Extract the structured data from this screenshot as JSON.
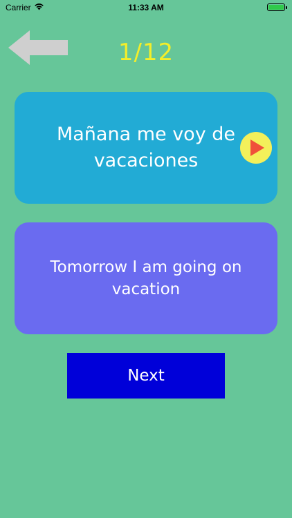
{
  "status_bar": {
    "carrier": "Carrier",
    "time": "11:33 AM",
    "battery_level": 1.0,
    "icons": {
      "wifi": "wifi-icon",
      "battery": "battery-icon"
    }
  },
  "navigation": {
    "back_icon": "arrow-left-icon"
  },
  "progress": {
    "counter": "1/12",
    "current": 1,
    "total": 12
  },
  "cards": {
    "spanish": {
      "text": "Mañana me voy de vacaciones",
      "play_icon": "play-icon"
    },
    "english": {
      "text": "Tomorrow I am going on vacation"
    }
  },
  "actions": {
    "next_label": "Next"
  },
  "colors": {
    "background": "#66c699",
    "counter": "#f4ee2a",
    "spanish_card": "#22abd5",
    "english_card": "#6a6bf0",
    "play_button": "#f3f05a",
    "play_triangle": "#f0503a",
    "next_button": "#0000d9",
    "back_arrow": "#cfcfcf"
  }
}
